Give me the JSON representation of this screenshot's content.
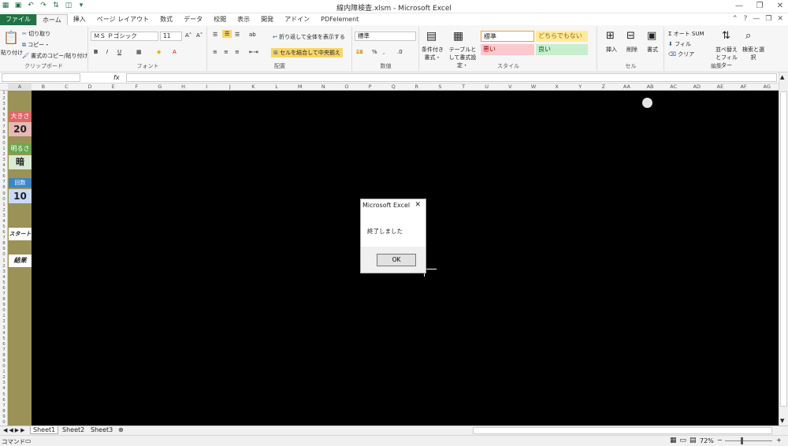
{
  "window": {
    "title": "線内障検査.xlsm - Microsoft Excel"
  },
  "tabs": [
    "ファイル",
    "ホーム",
    "挿入",
    "ページ レイアウト",
    "数式",
    "データ",
    "校閲",
    "表示",
    "開発",
    "アドイン",
    "PDFelement"
  ],
  "ribbon": {
    "clipboard": {
      "paste": "貼り付け",
      "cut": "切り取り",
      "copy": "コピー・",
      "format_painter": "書式のコピー/貼り付け",
      "label": "クリップボード"
    },
    "font": {
      "name": "ＭＳ Ｐゴシック",
      "size": "11",
      "label": "フォント"
    },
    "alignment": {
      "wrap": "折り返して全体を表示する",
      "merge": "セルを結合して中央揃え",
      "label": "配置"
    },
    "number": {
      "format": "標準",
      "label": "数値"
    },
    "styles": {
      "conditional": "条件付き書式・",
      "table": "テーブルとして書式設定・",
      "standard": "標準",
      "neutral": "どちらでもない",
      "bad": "悪い",
      "good": "良い",
      "label": "スタイル"
    },
    "cells": {
      "insert": "挿入",
      "delete": "削除",
      "format": "書式",
      "label": "セル"
    },
    "editing": {
      "autosum": "オート SUM",
      "fill": "フィル",
      "clear": "クリア",
      "sort": "並べ替えとフィルター",
      "find": "検索と選択",
      "label": "編集"
    }
  },
  "formula": {
    "namebox": "",
    "fx": "fx"
  },
  "columns": [
    "A",
    "B",
    "C",
    "D",
    "E",
    "F",
    "G",
    "H",
    "I",
    "J",
    "K",
    "L",
    "M",
    "N",
    "O",
    "P",
    "Q",
    "R",
    "S",
    "T",
    "U",
    "V",
    "W",
    "X",
    "Y",
    "Z",
    "AA",
    "AB",
    "AC",
    "AD",
    "AE",
    "AF",
    "AG"
  ],
  "rows": [
    "1",
    "2",
    "3",
    "4",
    "5",
    "6",
    "7",
    "8",
    "9",
    "0",
    "1",
    "2",
    "3",
    "4",
    "5",
    "6",
    "7",
    "8",
    "9",
    "0",
    "1",
    "2",
    "3",
    "4",
    "5",
    "6",
    "7",
    "8",
    "9",
    "0",
    "1",
    "2",
    "3",
    "4",
    "5",
    "6",
    "7",
    "8",
    "9",
    "0",
    "1",
    "2",
    "3",
    "4",
    "5",
    "6",
    "7",
    "8",
    "9",
    "0",
    "1",
    "2",
    "3",
    "4",
    "5",
    "6",
    "7",
    "8",
    "9",
    "0"
  ],
  "panel": {
    "size_label": "大きさ",
    "size_value": "20",
    "bright_label": "明るさ",
    "bright_value": "暗",
    "count_label": "回数",
    "count_value": "10",
    "start": "スタート",
    "result": "結果"
  },
  "dialog": {
    "title": "Microsoft Excel",
    "message": "終了しました",
    "ok": "OK"
  },
  "sheets": [
    "Sheet1",
    "Sheet2",
    "Sheet3"
  ],
  "status": {
    "mode": "コマンド",
    "zoom": "72%"
  },
  "colors": {
    "excel_green": "#217346",
    "panel_bg": "#9a9257"
  }
}
